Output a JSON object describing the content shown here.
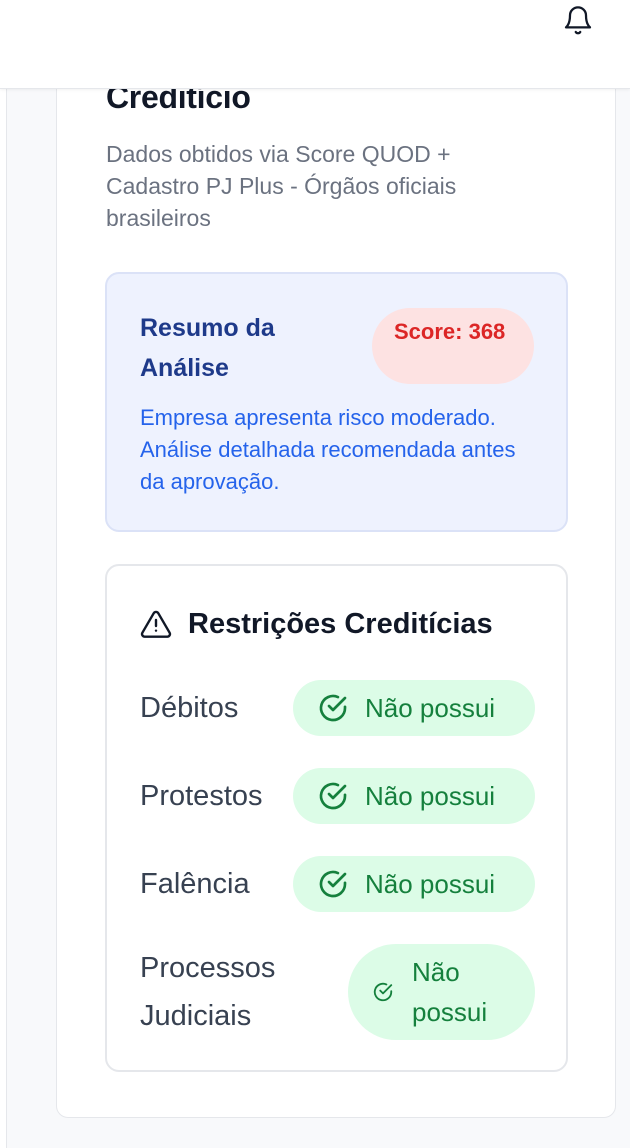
{
  "header": {
    "notifications_icon": "bell-icon"
  },
  "card": {
    "title": "Creditício",
    "description": "Dados obtidos via Score QUOD + Cadastro PJ Plus - Órgãos oficiais brasileiros"
  },
  "summary": {
    "title": "Resumo da Análise",
    "score_label": "Score: 368",
    "text": "Empresa apresenta risco moderado. Análise detalhada recomendada antes da aprovação.",
    "colors": {
      "background": "#eef2fe",
      "title": "#1e3a8a",
      "text": "#2563eb",
      "score_bg": "#fde2e2",
      "score_text": "#dc2626"
    }
  },
  "restrictions": {
    "icon": "warning-triangle-icon",
    "title": "Restrições Creditícias",
    "items": [
      {
        "label": "Débitos",
        "status": "Não possui",
        "icon": "check-circle-icon"
      },
      {
        "label": "Protestos",
        "status": "Não possui",
        "icon": "check-circle-icon"
      },
      {
        "label": "Falência",
        "status": "Não possui",
        "icon": "check-circle-icon"
      },
      {
        "label": "Processos Judiciais",
        "status": "Não possui",
        "icon": "check-circle-icon"
      }
    ],
    "colors": {
      "status_bg": "#dcfce7",
      "status_text": "#15803d"
    }
  }
}
